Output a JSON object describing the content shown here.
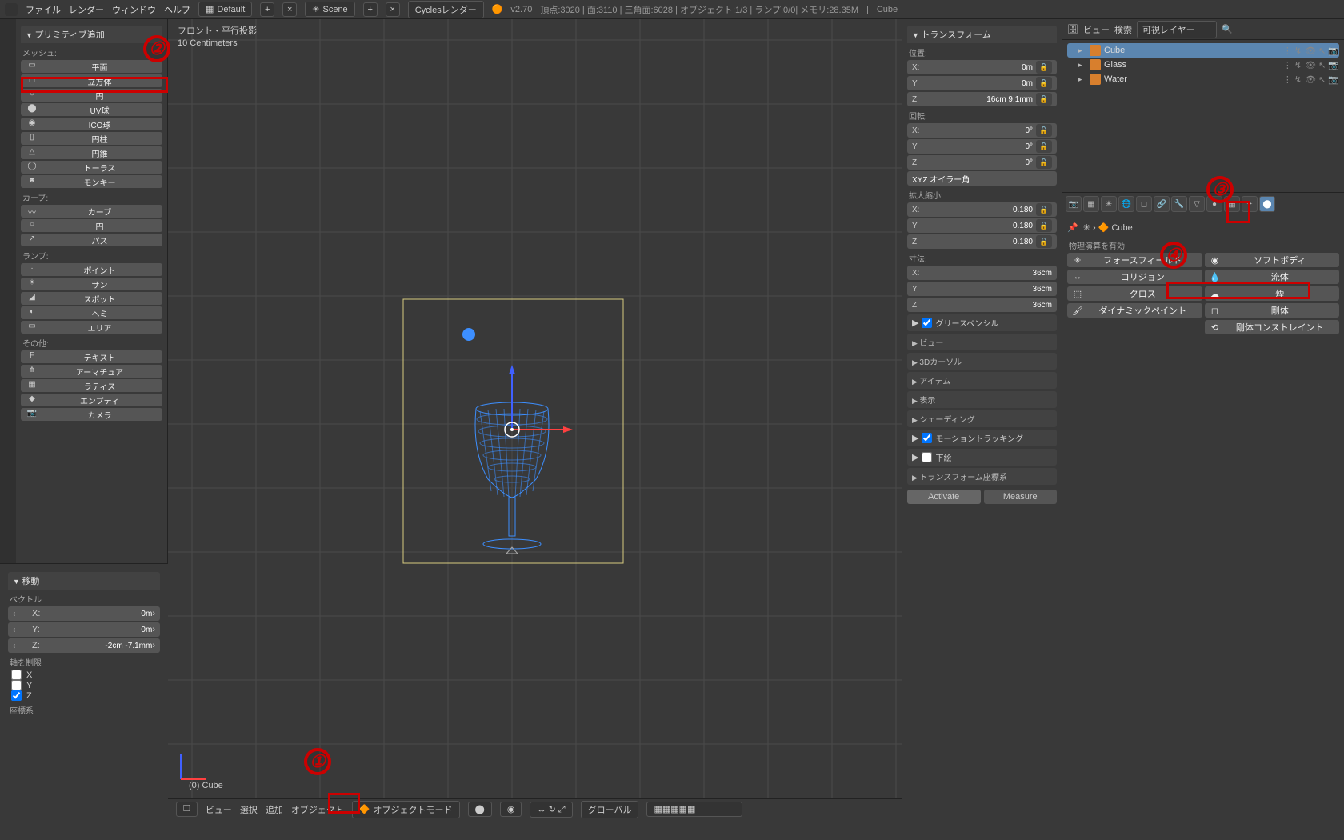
{
  "menu": {
    "file": "ファイル",
    "render": "レンダー",
    "window": "ウィンドウ",
    "help": "ヘルプ"
  },
  "header": {
    "layout": "Default",
    "scene": "Scene",
    "engine": "Cyclesレンダー",
    "version": "v2.70",
    "stats": "頂点:3020 | 面:3110 | 三角面:6028 | オブジェクト:1/3 | ランプ:0/0| メモリ:28.35M",
    "object": "Cube"
  },
  "toolshelf": {
    "title": "プリミティブ追加",
    "mesh_label": "メッシュ:",
    "mesh": [
      {
        "icon": "▭",
        "label": "平面"
      },
      {
        "icon": "◻",
        "label": "立方体"
      },
      {
        "icon": "○",
        "label": "円"
      },
      {
        "icon": "⬤",
        "label": "UV球"
      },
      {
        "icon": "◉",
        "label": "ICO球"
      },
      {
        "icon": "▯",
        "label": "円柱"
      },
      {
        "icon": "△",
        "label": "円錐"
      },
      {
        "icon": "◯",
        "label": "トーラス"
      },
      {
        "icon": "☻",
        "label": "モンキー"
      }
    ],
    "curve_label": "カーブ:",
    "curve": [
      {
        "icon": "〰",
        "label": "カーブ"
      },
      {
        "icon": "○",
        "label": "円"
      },
      {
        "icon": "↗",
        "label": "パス"
      }
    ],
    "lamp_label": "ランプ:",
    "lamp": [
      {
        "icon": "·",
        "label": "ポイント"
      },
      {
        "icon": "☀",
        "label": "サン"
      },
      {
        "icon": "◢",
        "label": "スポット"
      },
      {
        "icon": "◐",
        "label": "ヘミ"
      },
      {
        "icon": "▭",
        "label": "エリア"
      }
    ],
    "other_label": "その他:",
    "other": [
      {
        "icon": "F",
        "label": "テキスト"
      },
      {
        "icon": "⋔",
        "label": "アーマチュア"
      },
      {
        "icon": "▦",
        "label": "ラティス"
      },
      {
        "icon": "◆",
        "label": "エンプティ"
      },
      {
        "icon": "📷",
        "label": "カメラ"
      }
    ]
  },
  "last_op": {
    "title": "移動",
    "vector": "ベクトル",
    "x": "X:",
    "xv": "0m",
    "y": "Y:",
    "yv": "0m",
    "z": "Z:",
    "zv": "-2cm -7.1mm",
    "constraint": "軸を制限",
    "cx": "X",
    "cy": "Y",
    "cz": "Z",
    "coord": "座標系"
  },
  "viewport": {
    "title": "フロント・平行投影",
    "grid": "10 Centimeters",
    "obj": "(0) Cube"
  },
  "n_panel": {
    "transform": "トランスフォーム",
    "loc": "位置:",
    "loc_x": "X:",
    "loc_xv": "0m",
    "loc_y": "Y:",
    "loc_yv": "0m",
    "loc_z": "Z:",
    "loc_zv": "16cm 9.1mm",
    "rot": "回転:",
    "rot_x": "X:",
    "rot_xv": "0°",
    "rot_y": "Y:",
    "rot_yv": "0°",
    "rot_z": "Z:",
    "rot_zv": "0°",
    "rotmode": "XYZ オイラー角",
    "scale": "拡大縮小:",
    "scl_x": "X:",
    "scl_xv": "0.180",
    "scl_y": "Y:",
    "scl_yv": "0.180",
    "scl_z": "Z:",
    "scl_zv": "0.180",
    "dim": "寸法:",
    "dim_x": "X:",
    "dim_xv": "36cm",
    "dim_y": "Y:",
    "dim_yv": "36cm",
    "dim_z": "Z:",
    "dim_zv": "36cm",
    "sections": [
      "グリースペンシル",
      "ビュー",
      "3Dカーソル",
      "アイテム",
      "表示",
      "シェーディング",
      "モーショントラッキング",
      "下絵",
      "トランスフォーム座標系"
    ],
    "activate": "Activate",
    "measure": "Measure"
  },
  "outliner": {
    "view": "ビュー",
    "search": "検索",
    "layers": "可視レイヤー",
    "items": [
      {
        "name": "Cube"
      },
      {
        "name": "Glass"
      },
      {
        "name": "Water"
      }
    ]
  },
  "props": {
    "crumb_obj": "Cube",
    "enable": "物理演算を有効",
    "buttons": [
      {
        "icon": "✳",
        "label": "フォースフィールド"
      },
      {
        "icon": "◉",
        "label": "ソフトボディ"
      },
      {
        "icon": "↔",
        "label": "コリジョン"
      },
      {
        "icon": "💧",
        "label": "流体"
      },
      {
        "icon": "⬚",
        "label": "クロス"
      },
      {
        "icon": "☁",
        "label": "煙"
      },
      {
        "icon": "🖌",
        "label": "ダイナミックペイント"
      },
      {
        "icon": "◻",
        "label": "剛体"
      },
      {
        "icon": "⟲",
        "label": "剛体コンストレイント"
      }
    ]
  },
  "footer": {
    "view": "ビュー",
    "select": "選択",
    "add": "追加",
    "object": "オブジェクト",
    "mode": "オブジェクトモード",
    "orient": "グローバル"
  },
  "annotations": {
    "n1": "①",
    "n2": "②",
    "n3": "③",
    "n4": "④"
  }
}
